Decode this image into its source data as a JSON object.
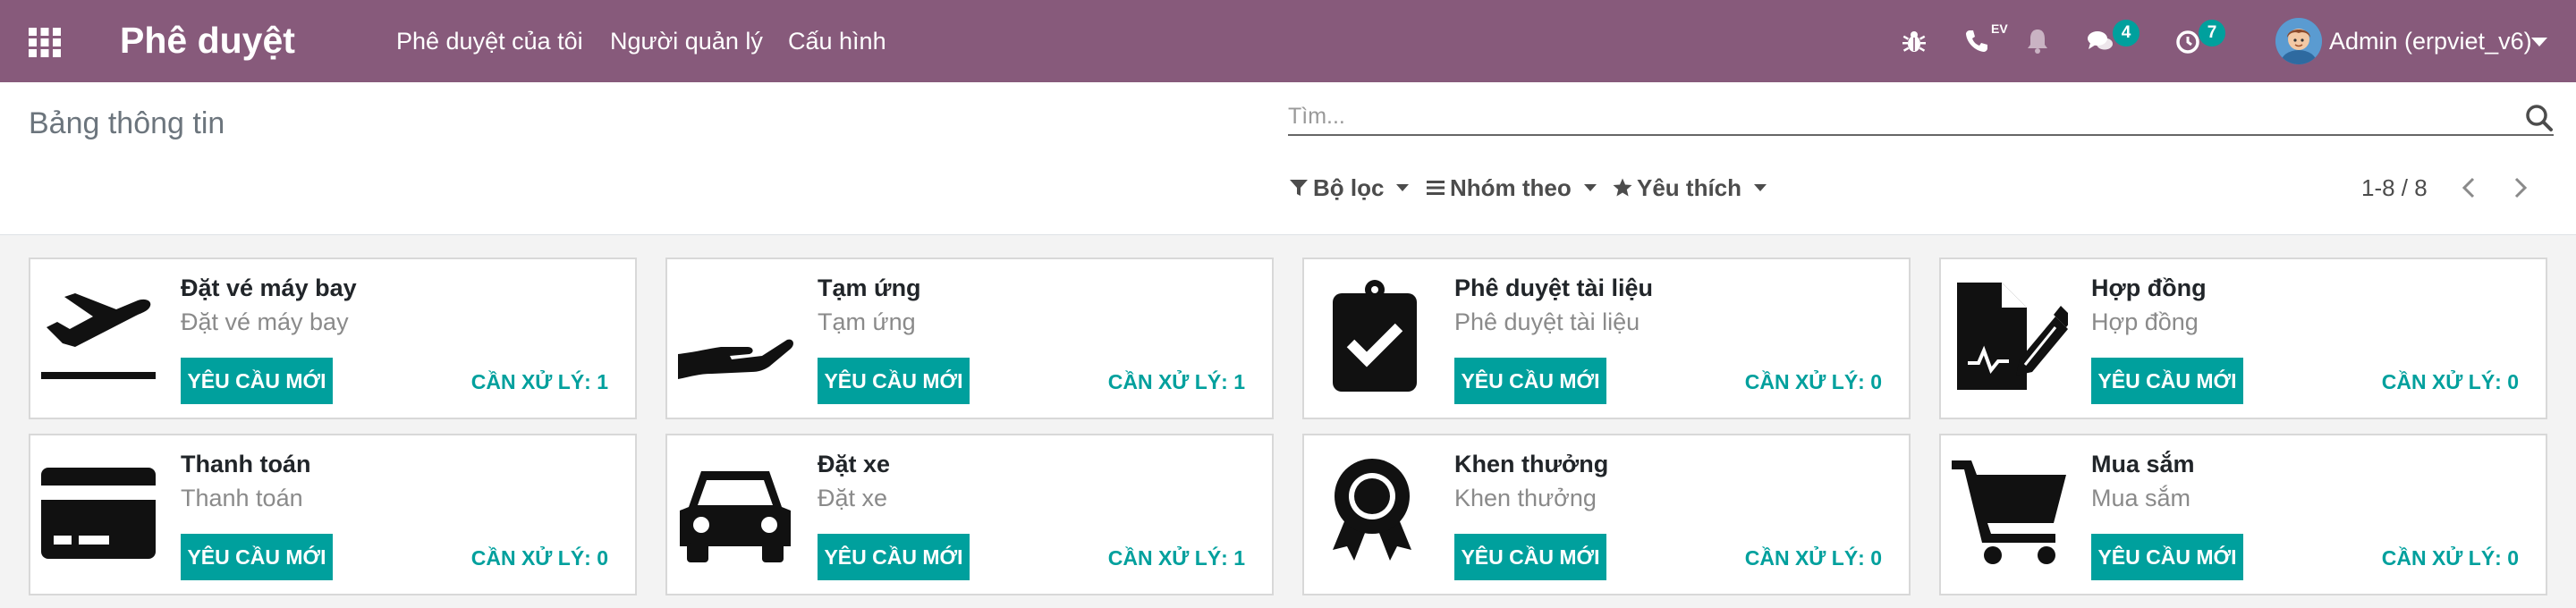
{
  "navbar": {
    "app_title": "Phê duyệt",
    "menu": [
      "Phê duyệt của tôi",
      "Người quản lý",
      "Cấu hình"
    ],
    "phone_tag": "EV",
    "messages_count": "4",
    "activities_count": "7",
    "user_name": "Admin (erpviet_v6)"
  },
  "control_panel": {
    "breadcrumb": "Bảng thông tin",
    "search_placeholder": "Tìm...",
    "filters_label": "Bộ lọc",
    "group_by_label": "Nhóm theo",
    "favorites_label": "Yêu thích",
    "pager": "1-8 / 8"
  },
  "cards": [
    {
      "icon": "airplane-icon",
      "title": "Đặt vé máy bay",
      "subtitle": "Đặt vé máy bay",
      "button": "YÊU CẦU MỚI",
      "todo": "CẦN XỬ LÝ: 1"
    },
    {
      "icon": "hand-icon",
      "title": "Tạm ứng",
      "subtitle": "Tạm ứng",
      "button": "YÊU CẦU MỚI",
      "todo": "CẦN XỬ LÝ: 1"
    },
    {
      "icon": "clipboard-check-icon",
      "title": "Phê duyệt tài liệu",
      "subtitle": "Phê duyệt tài liệu",
      "button": "YÊU CẦU MỚI",
      "todo": "CẦN XỬ LÝ: 0"
    },
    {
      "icon": "contract-sign-icon",
      "title": "Hợp đồng",
      "subtitle": "Hợp đồng",
      "button": "YÊU CẦU MỚI",
      "todo": "CẦN XỬ LÝ: 0"
    },
    {
      "icon": "credit-card-icon",
      "title": "Thanh toán",
      "subtitle": "Thanh toán",
      "button": "YÊU CẦU MỚI",
      "todo": "CẦN XỬ LÝ: 0"
    },
    {
      "icon": "car-icon",
      "title": "Đặt xe",
      "subtitle": "Đặt xe",
      "button": "YÊU CẦU MỚI",
      "todo": "CẦN XỬ LÝ: 1"
    },
    {
      "icon": "award-icon",
      "title": "Khen thưởng",
      "subtitle": "Khen thưởng",
      "button": "YÊU CẦU MỚI",
      "todo": "CẦN XỬ LÝ: 0"
    },
    {
      "icon": "shopping-cart-icon",
      "title": "Mua sắm",
      "subtitle": "Mua sắm",
      "button": "YÊU CẦU MỚI",
      "todo": "CẦN XỬ LÝ: 0"
    }
  ],
  "colors": {
    "navbar": "#875a7b",
    "accent": "#00a09d",
    "muted_text": "#8a8a8a"
  }
}
